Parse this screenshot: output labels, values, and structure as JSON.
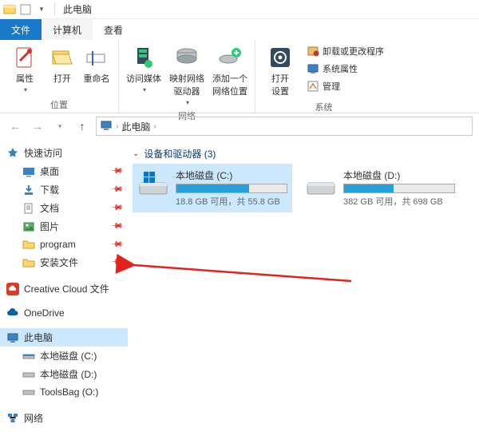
{
  "window": {
    "title": "此电脑"
  },
  "tabs": {
    "file": "文件",
    "computer": "计算机",
    "view": "查看"
  },
  "ribbon": {
    "group_location": {
      "label": "位置",
      "properties": "属性",
      "open": "打开",
      "rename": "重命名"
    },
    "group_network": {
      "label": "网络",
      "access_media": "访问媒体",
      "map_drive": "映射网络\n驱动器",
      "add_location": "添加一个\n网络位置"
    },
    "group_system": {
      "label": "系统",
      "open_settings": "打开\n设置",
      "uninstall": "卸载或更改程序",
      "sys_props": "系统属性",
      "manage": "管理"
    }
  },
  "breadcrumb": {
    "root": "此电脑"
  },
  "sidebar": {
    "quick_access": "快速访问",
    "desktop": "桌面",
    "downloads": "下载",
    "documents": "文档",
    "pictures": "图片",
    "program": "program",
    "install_files": "安装文件",
    "creative_cloud": "Creative Cloud 文件",
    "onedrive": "OneDrive",
    "this_pc": "此电脑",
    "disk_c": "本地磁盘 (C:)",
    "disk_d": "本地磁盘 (D:)",
    "toolsbag": "ToolsBag (O:)",
    "network": "网络"
  },
  "content": {
    "section_header": "设备和驱动器 (3)",
    "drives": [
      {
        "name": "本地磁盘 (C:)",
        "sub": "18.8 GB 可用，共 55.8 GB",
        "used_pct": 66,
        "selected": true
      },
      {
        "name": "本地磁盘 (D:)",
        "sub": "382 GB 可用，共 698 GB",
        "used_pct": 45,
        "selected": false
      }
    ]
  }
}
